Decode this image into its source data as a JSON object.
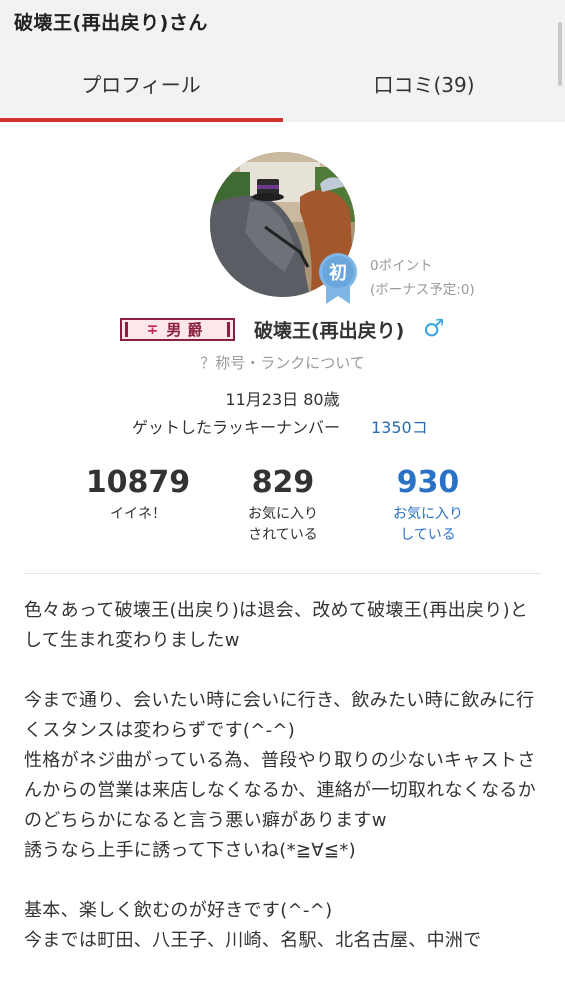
{
  "header": {
    "title": "破壊王(再出戻り)さん"
  },
  "tabs": [
    {
      "label": "プロフィール",
      "active": true
    },
    {
      "label": "口コミ(39)",
      "active": false
    }
  ],
  "profile": {
    "first_badge": "初",
    "points": "0ポイント",
    "bonus": "(ボーナス予定:0)",
    "rank_mark": "∓",
    "rank_title": "男爵",
    "username": "破壊王(再出戻り)",
    "gender_symbol": "♂",
    "rank_link": "？称号・ランクについて",
    "birth_age": "11月23日 80歳",
    "lucky_label": "ゲットしたラッキーナンバー",
    "lucky_value": "1350コ"
  },
  "stats": [
    {
      "value": "10879",
      "label_1": "イイネ！",
      "label_2": ""
    },
    {
      "value": "829",
      "label_1": "お気に入り",
      "label_2": "されている"
    },
    {
      "value": "930",
      "label_1": "お気に入り",
      "label_2": "している"
    }
  ],
  "colors": {
    "accent_red": "#d0342c",
    "link_blue": "#2b72c7",
    "gender_blue": "#3aa8e0"
  },
  "bio": "色々あって破壊王(出戻り)は退会、改めて破壊王(再出戻り)として生まれ変わりましたw\n\n今まで通り、会いたい時に会いに行き、飲みたい時に飲みに行くスタンスは変わらずです(^-^)\n性格がネジ曲がっている為、普段やり取りの少ないキャストさんからの営業は来店しなくなるか、連絡が一切取れなくなるかのどちらかになると言う悪い癖がありますw\n誘うなら上手に誘って下さいね(*≧∀≦*)\n\n基本、楽しく飲むのが好きです(^-^)\n今までは町田、八王子、川崎、名駅、北名古屋、中洲で"
}
